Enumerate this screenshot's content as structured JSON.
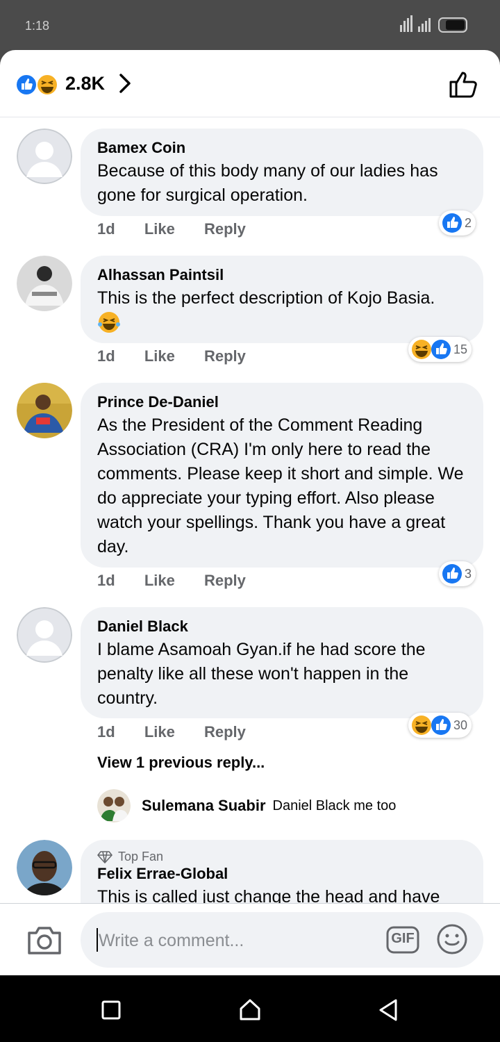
{
  "status_bar": {
    "time": "1:18"
  },
  "header": {
    "reaction_count": "2.8K"
  },
  "comments": [
    {
      "author": "Bamex Coin",
      "text": "Because of this body many of our ladies has gone for surgical operation.",
      "time": "1d",
      "like": "Like",
      "reply": "Reply",
      "reaction_count": "2"
    },
    {
      "author": "Alhassan Paintsil",
      "text": "This is the perfect description of Kojo Basia.",
      "time": "1d",
      "like": "Like",
      "reply": "Reply",
      "reaction_count": "15"
    },
    {
      "author": "Prince De-Daniel",
      "text": "As the President of the Comment Reading Association (CRA) I'm only here to read the comments. Please keep it short and simple. We do appreciate your typing effort.  Also please watch your spellings. Thank you have a great day.",
      "time": "1d",
      "like": "Like",
      "reply": "Reply",
      "reaction_count": "3"
    },
    {
      "author": "Daniel Black",
      "text": "I blame Asamoah Gyan.if he had score the penalty like all these won't happen in the country.",
      "time": "1d",
      "like": "Like",
      "reply": "Reply",
      "reaction_count": "30",
      "view_previous": "View 1 previous reply...",
      "reply_preview": {
        "author": "Sulemana Suabir",
        "text": "Daniel Black me too"
      }
    },
    {
      "badge": "Top Fan",
      "author": "Felix Errae-Global",
      "text": "This is called just change the head and have"
    }
  ],
  "composer": {
    "placeholder": "Write a comment...",
    "gif_label": "GIF"
  },
  "icons": {
    "like_icon": "thumbs-up-icon",
    "haha_icon": "laughing-face-icon",
    "chevron": "chevron-right-icon",
    "camera": "camera-icon",
    "emoji": "smiley-face-icon",
    "top_fan": "diamond-icon"
  },
  "colors": {
    "like_blue": "#1877f2",
    "haha_yellow": "#f7b125",
    "bubble_bg": "#f0f2f5",
    "meta_gray": "#65676b"
  }
}
